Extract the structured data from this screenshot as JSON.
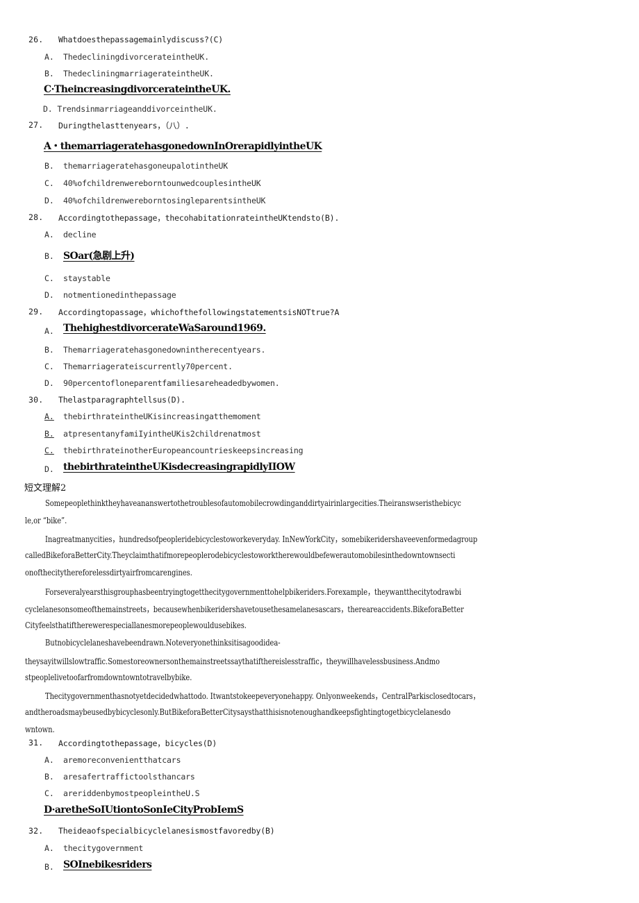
{
  "document": {
    "type": "scanned-exam-worksheet",
    "page_background": "#ffffff",
    "text_color": "#141414",
    "answer_color": "#0c0c0c"
  },
  "questions": [
    {
      "number": "26.",
      "stem": "Whatdoesthepassagemainlydiscuss?(C)",
      "options": [
        {
          "label": "A.",
          "text": "ThedecliningdivorcerateintheUK.",
          "style": "plain"
        },
        {
          "label": "B.",
          "text": "ThedecliningmarriagerateintheUK.",
          "style": "plain"
        },
        {
          "label": "",
          "text": "C·TheincreasingdivorcerateintheUK.",
          "style": "answer"
        },
        {
          "label": "",
          "text": "D. TrendsinmarriageanddivorceintheUK.",
          "style": "plain-nolabel"
        }
      ]
    },
    {
      "number": "27.",
      "stem": "Duringthelasttenyears，（八）.",
      "options": [
        {
          "label": "",
          "text": "A・themarriageratehasgonedownInOrerapidlyintheUK",
          "style": "answer"
        },
        {
          "label": "B.",
          "text": "themarriageratehasgoneupalotintheUK",
          "style": "plain"
        },
        {
          "label": "C.",
          "text": "40%ofchildrenwereborntounwedcouplesintheUK",
          "style": "plain"
        },
        {
          "label": "D.",
          "text": "40%ofchildrenwereborntosingleparentsintheUK",
          "style": "plain"
        }
      ]
    },
    {
      "number": "28.",
      "stem": "Accordingtothepassage，thecohabitationrateintheUKtendsto(B).",
      "options": [
        {
          "label": "A.",
          "text": "decline",
          "style": "plain"
        },
        {
          "label": "B.",
          "text": "SOar(急剧上升)",
          "style": "answer-with-label"
        },
        {
          "label": "C.",
          "text": "staystable",
          "style": "plain"
        },
        {
          "label": "D.",
          "text": "notmentionedinthepassage",
          "style": "plain"
        }
      ]
    },
    {
      "number": "29.",
      "stem": "Accordingtopassage，whichofthefollowingstatementsisNOTtrue?A",
      "options": [
        {
          "label": "A.",
          "text": "ThehighestdivorcerateWaSaround1969.",
          "style": "answer-with-label"
        },
        {
          "label": "B.",
          "text": "Themarriageratehasgonedownintherecentyears.",
          "style": "plain"
        },
        {
          "label": "C.",
          "text": "Themarriagerateiscurrently70percent.",
          "style": "plain"
        },
        {
          "label": "D.",
          "text": "90percentofloneparentfamiliesareheadedbywomen.",
          "style": "plain"
        }
      ]
    },
    {
      "number": "30.",
      "stem": "Thelastparagraphtellsus(D).",
      "options": [
        {
          "label": "A.",
          "text": "thebirthrateintheUKisincreasingatthemoment",
          "style": "plain-underline-label"
        },
        {
          "label": "B.",
          "text": "atpresentanyfamiIyintheUKis2childrenatmost",
          "style": "plain-underline-label"
        },
        {
          "label": "C.",
          "text": "thebirthrateinotherEuropeancountrieskeepsincreasing",
          "style": "plain-underline-label"
        },
        {
          "label": "D.",
          "text": "thebirthrateintheUKisdecreasingrapidlyIIOW",
          "style": "answer-with-label"
        }
      ]
    },
    {
      "number": "31.",
      "stem": "Accordingtothepassage，bicycles(D)",
      "options": [
        {
          "label": "A.",
          "text": "aremoreconvenientthatcars",
          "style": "plain"
        },
        {
          "label": "B.",
          "text": "aresafertraffictoolsthancars",
          "style": "plain"
        },
        {
          "label": "C.",
          "text": "areriddenbymostpeopleintheU.S",
          "style": "plain"
        },
        {
          "label": "",
          "text": "D·aretheSoIUtiontoSonIeCityProbIemS",
          "style": "answer"
        }
      ]
    },
    {
      "number": "32.",
      "stem": "Theideaofspecialbicyclelanesismostfavoredby(B)",
      "options": [
        {
          "label": "A.",
          "text": "thecitygovernment",
          "style": "plain"
        },
        {
          "label": "B.",
          "text": "SOInebikesriders",
          "style": "answer-with-label"
        }
      ]
    }
  ],
  "passage": {
    "heading": "短文理解2",
    "lines": [
      "Somepeoplethinktheyhaveananswertothetroublesofautomobilecrowdinganddirtyairinlargecities.Theiranswseristhebicyc",
      "le,or “bike”.",
      "Inagreatmanycities，hundredsofpeopleridebicyclestoworkeveryday. InNewYorkCity，somebikeridershaveevenformedagroup",
      "calledBikeforaBetterCity.Theyclaimthatifmorepeoplerodebicyclestoworktherewouldbefewerautomobilesinthedowntownsecti",
      "onofthecitythereforelessdirtyairfromcarengines.",
      "Forseveralyearsthisgrouphasbeentryingtogetthecitygovernmenttohelpbikeriders.Forexample，theywantthecitytodrawbi",
      "cyclelanesonsomeofthemainstreets，becausewhenbikeridershavetousethesamelanesascars，thereareaccidents.BikeforaBetter",
      "Cityfeelsthatiftherewerespeciallanesmorepeoplewouldusebikes.",
      "Butnobicyclelaneshavebeendrawn.Noteveryonethinksitisagoodidea-",
      "theysayitwillslowtraffic.Somestoreownersonthemainstreetssaythatifthereislesstraffic，theywillhavelessbusiness.Andmo",
      "stpeoplelivetoofarfromdowntowntotravelbybike.",
      "Thecitygovernmenthasnotyetdecidedwhattodo. Itwantstokeepeveryonehappy. Onlyonweekends，CentralParkisclosedtocars，",
      "andtheroadsmaybeusedbybicyclesonly.ButBikeforaBetterCitysaysthatthisisnotenoughandkeepsfightingtogetbicyclelanesdo",
      "wntown."
    ]
  }
}
